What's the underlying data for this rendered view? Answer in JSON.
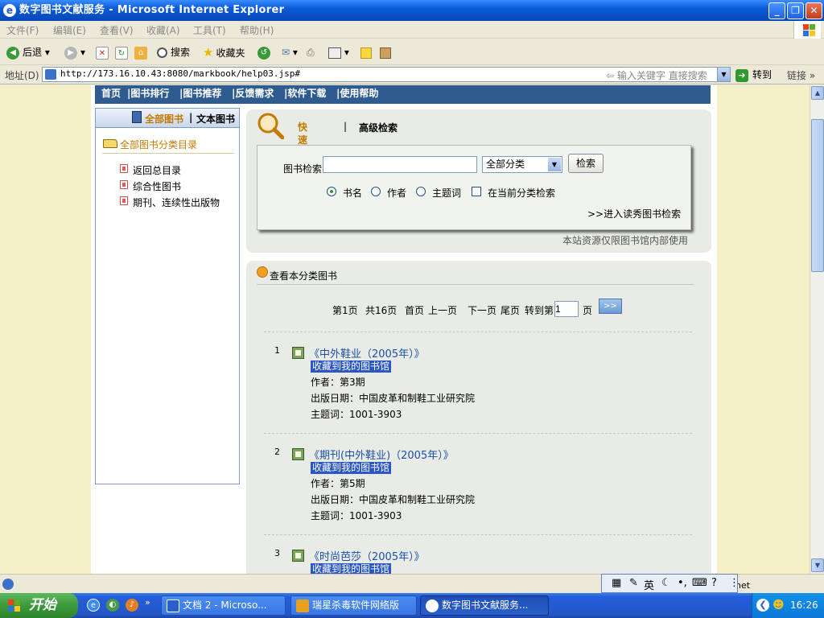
{
  "window": {
    "title": "数字图书文献服务 - Microsoft Internet Explorer"
  },
  "menu": [
    "文件(F)",
    "编辑(E)",
    "查看(V)",
    "收藏(A)",
    "工具(T)",
    "帮助(H)"
  ],
  "toolbar": {
    "back": "后退",
    "search": "搜索",
    "favorites": "收藏夹"
  },
  "address": {
    "label": "地址(D)",
    "url": "http://173.16.10.43:8080/markbook/help03.jsp#",
    "search_hint": "输入关键字 直接搜索",
    "go": "转到",
    "links": "链接"
  },
  "nav": [
    "首页",
    "|图书排行",
    "|图书推荐",
    "|反馈需求",
    "|软件下载",
    "|使用帮助"
  ],
  "left_panel": {
    "tab_all": "全部图书",
    "tab_sep": "|",
    "tab_text": "文本图书",
    "catalog_title": "全部图书分类目录",
    "items": [
      "返回总目录",
      "综合性图书",
      "期刊、连续性出版物"
    ]
  },
  "search": {
    "quick_label": "快速检索",
    "separator": "|",
    "advanced_label": "高级检索",
    "field_label": "图书检索",
    "input_value": "",
    "category_selected": "全部分类",
    "button": "检索",
    "options": [
      "书名",
      "作者",
      "主题词"
    ],
    "selected_option": "书名",
    "checkbox_label": "在当前分类检索",
    "checkbox_checked": false,
    "advanced_link": ">>进入读秀图书检索",
    "notice": "本站资源仅限图书馆内部使用"
  },
  "results": {
    "heading": "查看本分类图书",
    "pager": {
      "current": "第1页",
      "total": "共16页",
      "first": "首页",
      "prev": "上一页",
      "next": "下一页",
      "last": "尾页",
      "goto_label": "转到第",
      "goto_value": "1",
      "page_suffix": "页",
      "go": ">>"
    },
    "books": [
      {
        "num": "1",
        "title": "《中外鞋业（2005年）》",
        "fav": "收藏到我的图书馆",
        "author": "作者：第3期",
        "publish": "出版日期：中国皮革和制鞋工业研究院",
        "subject": "主题词：1001-3903"
      },
      {
        "num": "2",
        "title": "《期刊(中外鞋业)（2005年）》",
        "fav": "收藏到我的图书馆",
        "author": "作者：第5期",
        "publish": "出版日期：中国皮革和制鞋工业研究院",
        "subject": "主题词：1001-3903"
      },
      {
        "num": "3",
        "title": "《时尚芭莎（2005年）》",
        "fav": "收藏到我的图书馆"
      }
    ]
  },
  "status": {
    "zone": "net"
  },
  "ime": {
    "mode": "英"
  },
  "taskbar": {
    "start": "开始",
    "tasks": [
      "文档 2 - Microso...",
      "瑞星杀毒软件网络版",
      "数字图书文献服务..."
    ],
    "clock": "16:26"
  }
}
